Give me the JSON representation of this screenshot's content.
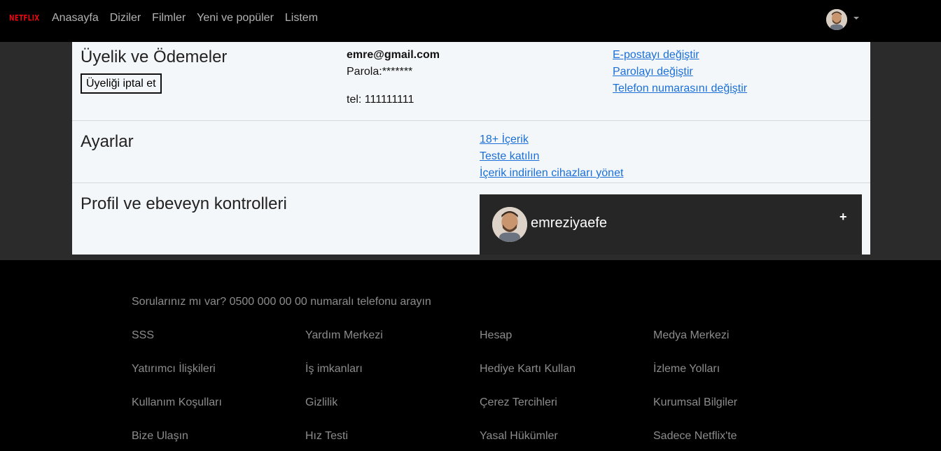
{
  "brand": {
    "logo_text": "NETFLIX",
    "accent": "#e50914"
  },
  "nav": {
    "links": [
      "Anasayfa",
      "Diziler",
      "Filmler",
      "Yeni ve popüler",
      "Listem"
    ]
  },
  "membership": {
    "title": "Üyelik ve Ödemeler",
    "cancel_label": "Üyeliği iptal et",
    "email": "emre@gmail.com",
    "password": "Parola:*******",
    "phone": "tel: 111111111",
    "links": [
      "E-postayı değiştir",
      "Parolayı değiştir",
      "Telefon numarasını değiştir"
    ]
  },
  "settings": {
    "title": "Ayarlar",
    "links": [
      "18+ İçerik",
      "Teste katılın",
      "İçerik indirilen cihazları yönet"
    ]
  },
  "profile": {
    "title": "Profil ve ebeveyn kontrolleri",
    "name": "emreziyaefe",
    "add_symbol": "+"
  },
  "footer": {
    "question": "Sorularınız mı var? 0500 000 00 00 numaralı telefonu arayın",
    "links": [
      [
        "SSS",
        "Yardım Merkezi",
        "Hesap",
        "Medya Merkezi"
      ],
      [
        "Yatırımcı İlişkileri",
        "İş imkanları",
        "Hediye Kartı Kullan",
        "İzleme Yolları"
      ],
      [
        "Kullanım Koşulları",
        "Gizlilik",
        "Çerez Tercihleri",
        "Kurumsal Bilgiler"
      ],
      [
        "Bize Ulaşın",
        "Hız Testi",
        "Yasal Hükümler",
        "Sadece Netflix'te"
      ]
    ]
  }
}
